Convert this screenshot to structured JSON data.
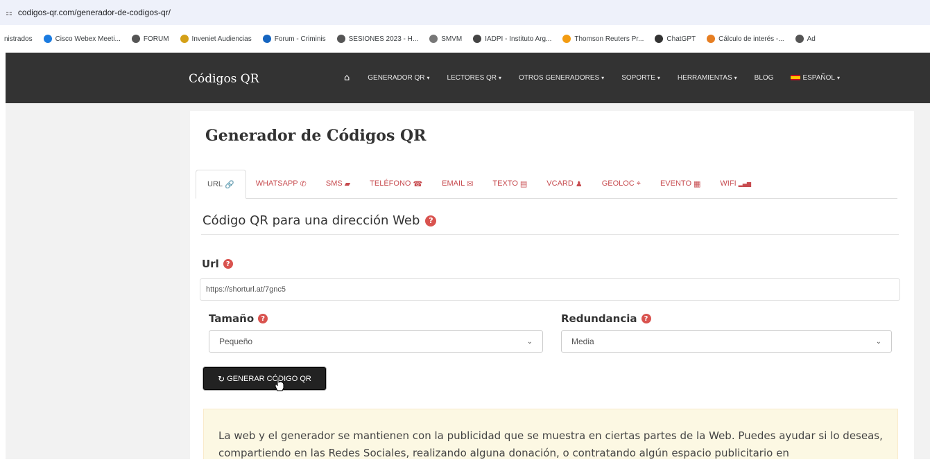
{
  "browser": {
    "url": "codigos-qr.com/generador-de-codigos-qr/",
    "bookmarks": [
      {
        "label": "nistrados",
        "icon": "none",
        "color": "#fff"
      },
      {
        "label": "Cisco Webex Meeti...",
        "icon": "webex-icon",
        "color": "#1b7be0"
      },
      {
        "label": "FORUM",
        "icon": "globe-icon",
        "color": "#555"
      },
      {
        "label": "Inveniet Audiencias",
        "icon": "inveniet-icon",
        "color": "#d4a017"
      },
      {
        "label": "Forum - Criminis",
        "icon": "forum-icon",
        "color": "#1565c0"
      },
      {
        "label": "SESIONES 2023 - H...",
        "icon": "globe-icon",
        "color": "#555"
      },
      {
        "label": "SMVM",
        "icon": "smvm-icon",
        "color": "#777"
      },
      {
        "label": "IADPI - Instituto Arg...",
        "icon": "iadpi-icon",
        "color": "#444"
      },
      {
        "label": "Thomson Reuters Pr...",
        "icon": "tr-icon",
        "color": "#f39c12"
      },
      {
        "label": "ChatGPT",
        "icon": "chatgpt-icon",
        "color": "#333"
      },
      {
        "label": "Cálculo de interés -...",
        "icon": "calc-icon",
        "color": "#e67e22"
      },
      {
        "label": "Ad",
        "icon": "globe-icon",
        "color": "#555"
      }
    ]
  },
  "navbar": {
    "brand": "Códigos QR",
    "items": [
      {
        "label": "GENERADOR QR",
        "caret": "▾"
      },
      {
        "label": "LECTORES QR",
        "caret": "▾"
      },
      {
        "label": "OTROS GENERADORES",
        "caret": "▾"
      },
      {
        "label": "SOPORTE",
        "caret": "▾"
      },
      {
        "label": "HERRAMIENTAS",
        "caret": "▾"
      },
      {
        "label": "BLOG",
        "caret": ""
      },
      {
        "label": "ESPAÑOL",
        "caret": "▾"
      }
    ]
  },
  "main": {
    "title": "Generador de Códigos QR",
    "tabs": [
      {
        "label": "URL",
        "icon": "🔗"
      },
      {
        "label": "WHATSAPP",
        "icon": "✆"
      },
      {
        "label": "SMS",
        "icon": "▰"
      },
      {
        "label": "TELÉFONO",
        "icon": "☎"
      },
      {
        "label": "EMAIL",
        "icon": "✉"
      },
      {
        "label": "TEXTO",
        "icon": "▤"
      },
      {
        "label": "VCARD",
        "icon": "♟"
      },
      {
        "label": "GEOLOC",
        "icon": "⌖"
      },
      {
        "label": "EVENTO",
        "icon": "▦"
      },
      {
        "label": "WIFI",
        "icon": "▂▄▆"
      }
    ],
    "section_title": "Código QR para una dirección Web",
    "url_label": "Url",
    "url_value": "https://shorturl.at/7gnc5",
    "size_label": "Tamaño",
    "size_value": "Pequeño",
    "redundancy_label": "Redundancia",
    "redundancy_value": "Media",
    "generate_button": "GENERAR CÓDIGO QR",
    "notice": "La web y el generador se mantienen con la publicidad que se muestra en ciertas partes de la Web. Puedes ayudar si lo deseas, compartiendo en las Redes Sociales, realizando alguna donación, o contratando algún espacio publicitario en"
  },
  "colors": {
    "navbar_bg": "#333333",
    "tab_link": "#c74b4f",
    "help_badge": "#d9534f",
    "notice_bg": "#fcf8e3",
    "button_bg": "#222222"
  }
}
